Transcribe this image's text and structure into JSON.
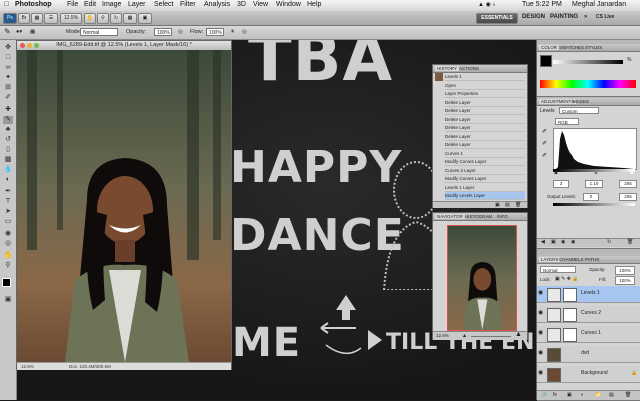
{
  "menubar": {
    "apple": "",
    "app_name": "Photoshop",
    "items": [
      "File",
      "Edit",
      "Image",
      "Layer",
      "Select",
      "Filter",
      "Analysis",
      "3D",
      "View",
      "Window",
      "Help"
    ],
    "clock": "Tue 5:22 PM",
    "user": "Meghal Janardan"
  },
  "appbar": {
    "logo": "Ps",
    "zoom": "12.5%",
    "workspaces": [
      "ESSENTIALS",
      "DESIGN",
      "PAINTING"
    ],
    "more": "»",
    "cs_live": "CS Live"
  },
  "options": {
    "mode_label": "Mode:",
    "mode_value": "Normal",
    "opacity_label": "Opacity:",
    "opacity_value": "100%",
    "flow_label": "Flow:",
    "flow_value": "100%"
  },
  "document": {
    "title": "IMG_6289-Edit.tif @ 12.5% (Levels 1, Layer Mask/16) *",
    "zoom": "12.5%",
    "doc_info": "Doc: 120.4M/300.6M"
  },
  "poster": {
    "line1": "TBA",
    "line2": "HAPPY",
    "line3": "DANCE",
    "line4": "ME",
    "line5": "TILL THE END"
  },
  "history": {
    "tabs": [
      "HISTORY",
      "ACTIONS"
    ],
    "items": [
      "Levels 1",
      "Open",
      "Layer Properties",
      "Delete Layer",
      "Delete Layer",
      "Delete Layer",
      "Delete Layer",
      "Delete Layer",
      "Delete Layer",
      "Curves 1",
      "Modify Curves Layer",
      "Curves 2 Layer",
      "Modify Curves Layer",
      "Levels 1 Layer",
      "Modify Levels Layer"
    ]
  },
  "navigator": {
    "tabs": [
      "NAVIGATOR",
      "HISTOGRAM",
      "INFO"
    ],
    "zoom": "12.5%"
  },
  "color_panel": {
    "tabs": [
      "COLOR",
      "SWATCHES",
      "STYLES"
    ],
    "percent": "%"
  },
  "adjustments": {
    "tabs": [
      "ADJUSTMENTS",
      "MASKS"
    ],
    "title": "Levels",
    "preset": "Custom",
    "channel": "RGB",
    "inputs": [
      "3",
      "1.10",
      "255"
    ],
    "output_label": "Output Levels:",
    "outputs": [
      "0",
      "255"
    ]
  },
  "layers": {
    "tabs": [
      "LAYERS",
      "CHANNELS",
      "PATHS"
    ],
    "blend_mode": "Normal",
    "opacity_label": "Opacity:",
    "opacity_value": "100%",
    "lock_label": "Lock:",
    "fill_label": "Fill:",
    "fill_value": "100%",
    "items": [
      {
        "name": "Levels 1",
        "selected": true
      },
      {
        "name": "Curves 2",
        "selected": false
      },
      {
        "name": "Curves 1",
        "selected": false
      },
      {
        "name": "dvd",
        "selected": false
      },
      {
        "name": "Background",
        "selected": false
      }
    ]
  },
  "colors": {
    "accent": "#5f9be0",
    "selection": "#a7c6ef"
  }
}
